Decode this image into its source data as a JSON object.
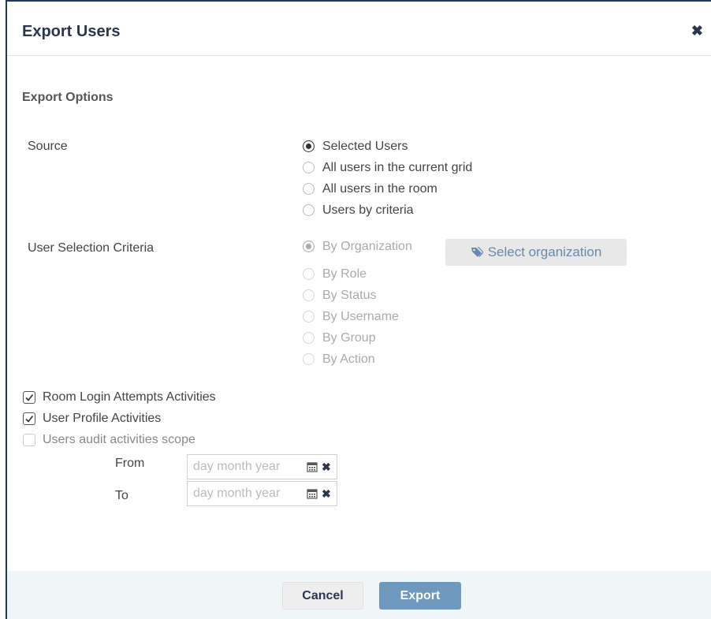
{
  "dialog": {
    "title": "Export Users",
    "close_icon": "close-icon"
  },
  "options": {
    "section_title": "Export Options",
    "source": {
      "label": "Source",
      "selected": "Selected Users",
      "items": [
        "Selected Users",
        "All users in the current grid",
        "All users in the room",
        "Users by criteria"
      ]
    },
    "criteria": {
      "label": "User Selection Criteria",
      "disabled": true,
      "selected": "By Organization",
      "items": [
        "By Organization",
        "By Role",
        "By Status",
        "By Username",
        "By Group",
        "By Action"
      ],
      "select_button_label": "Select organization",
      "select_button_icon": "tags-icon"
    },
    "activities": [
      {
        "label": "Room Login Attempts Activities",
        "checked": true
      },
      {
        "label": "User Profile Activities",
        "checked": true
      },
      {
        "label": "Users audit activities scope",
        "checked": false
      }
    ],
    "date_range": {
      "from_label": "From",
      "to_label": "To",
      "from_placeholder": "day month year",
      "to_placeholder": "day month year"
    }
  },
  "footer": {
    "cancel_label": "Cancel",
    "export_label": "Export"
  },
  "colors": {
    "title": "#2a3550",
    "export_button": "#6e98bd",
    "footer_bg": "#eef6f8"
  }
}
